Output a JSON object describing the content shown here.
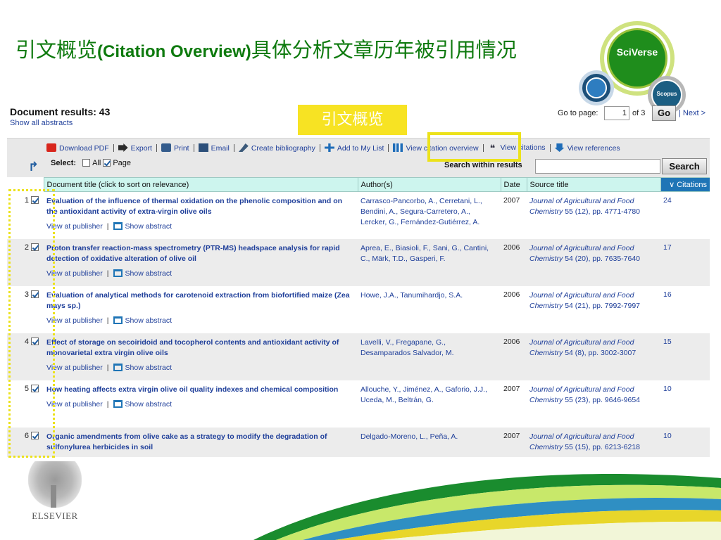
{
  "slide": {
    "title_cn": "引文概览",
    "title_en": "(Citation Overview)",
    "title_cn_tail": "具体分析文章历年被引用情况",
    "callout": "引文概览"
  },
  "logos": {
    "sciverse": "SciVerse",
    "scopus": "Scopus",
    "elsevier": "ELSEVIER"
  },
  "header": {
    "results_title": "Document results: 43",
    "show_abstracts": "Show all abstracts",
    "goto_label": "Go to page:",
    "page_value": "1",
    "of_pages": "of 3",
    "go_button": "Go",
    "next_link": "| Next >"
  },
  "toolbar": {
    "download_pdf": "Download PDF",
    "export": "Export",
    "print": "Print",
    "email": "Email",
    "create_bibliography": "Create bibliography",
    "add_to_list": "Add to My List",
    "view_citation_overview": "View citation overview",
    "view_citations": "View citations",
    "view_references": "View references",
    "select_label": "Select:",
    "all_label": "All",
    "page_label": "Page",
    "search_within": "Search within results",
    "search_button": "Search"
  },
  "table": {
    "headers": {
      "title": "Document title (click to sort on relevance)",
      "authors": "Author(s)",
      "date": "Date",
      "source": "Source title",
      "citations": "∨ Citations"
    },
    "view_at_publisher": "View at publisher",
    "show_abstract": "Show abstract",
    "rows": [
      {
        "num": "1",
        "title": "Evaluation of the influence of thermal oxidation on the phenolic composition and on the antioxidant activity of extra-virgin olive oils",
        "authors": "Carrasco-Pancorbo, A., Cerretani, L., Bendini, A., Segura-Carretero, A., Lercker, G., Fernández-Gutiérrez, A.",
        "date": "2007",
        "journal": "Journal of Agricultural and Food Chemistry",
        "details": "55 (12), pp. 4771-4780",
        "citations": "24"
      },
      {
        "num": "2",
        "title": "Proton transfer reaction-mass spectrometry (PTR-MS) headspace analysis for rapid detection of oxidative alteration of olive oil",
        "authors": "Aprea, E., Biasioli, F., Sani, G., Cantini, C., Märk, T.D., Gasperi, F.",
        "date": "2006",
        "journal": "Journal of Agricultural and Food Chemistry",
        "details": "54 (20), pp. 7635-7640",
        "citations": "17"
      },
      {
        "num": "3",
        "title": "Evaluation of analytical methods for carotenoid extraction from biofortified maize (Zea mays sp.)",
        "authors": "Howe, J.A., Tanumihardjo, S.A.",
        "date": "2006",
        "journal": "Journal of Agricultural and Food Chemistry",
        "details": "54 (21), pp. 7992-7997",
        "citations": "16"
      },
      {
        "num": "4",
        "title": "Effect of storage on secoiridoid and tocopherol contents and antioxidant activity of monovarietal extra virgin olive oils",
        "authors": "Lavelli, V., Fregapane, G., Desamparados Salvador, M.",
        "date": "2006",
        "journal": "Journal of Agricultural and Food Chemistry",
        "details": "54 (8), pp. 3002-3007",
        "citations": "15"
      },
      {
        "num": "5",
        "title": "How heating affects extra virgin olive oil quality indexes and chemical composition",
        "authors": "Allouche, Y., Jiménez, A., Gaforio, J.J., Uceda, M., Beltrán, G.",
        "date": "2007",
        "journal": "Journal of Agricultural and Food Chemistry",
        "details": "55 (23), pp. 9646-9654",
        "citations": "10"
      },
      {
        "num": "6",
        "title": "Organic amendments from olive cake as a strategy to modify the degradation of sulfonylurea herbicides in soil",
        "authors": "Delgado-Moreno, L., Peña, A.",
        "date": "2007",
        "journal": "Journal of Agricultural and Food Chemistry",
        "details": "55 (15), pp. 6213-6218",
        "citations": "10"
      }
    ]
  },
  "colors": {
    "title_green": "#0e7a0e",
    "link_blue": "#1f3f9a",
    "header_teal": "#cdf5ee",
    "citations_header": "#1f75b6",
    "highlight_yellow": "#ece21b",
    "callout_yellow": "#f7e323"
  }
}
